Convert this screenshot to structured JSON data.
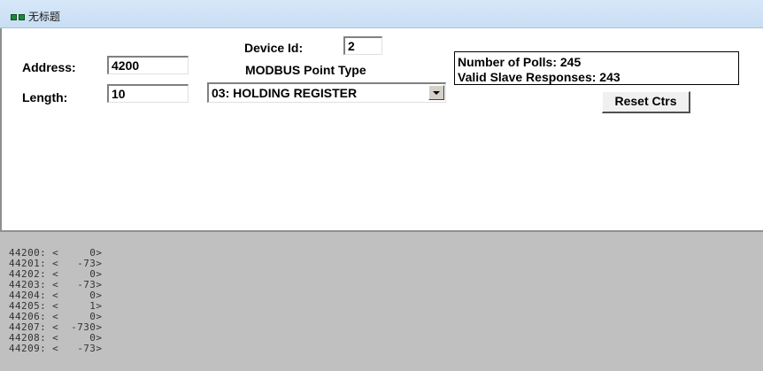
{
  "window": {
    "title": "无标题"
  },
  "form": {
    "address_label": "Address:",
    "address_value": "4200",
    "length_label": "Length:",
    "length_value": "10",
    "device_id_label": "Device Id:",
    "device_id_value": "2",
    "point_type_label": "MODBUS Point Type",
    "point_type_selected": "03: HOLDING REGISTER"
  },
  "counters": {
    "polls": "Number of Polls: 245",
    "valid_responses": "Valid Slave Responses: 243",
    "reset_label": "Reset Ctrs"
  },
  "registers": [
    {
      "address": "44200",
      "value": "0"
    },
    {
      "address": "44201",
      "value": "-73"
    },
    {
      "address": "44202",
      "value": "0"
    },
    {
      "address": "44203",
      "value": "-73"
    },
    {
      "address": "44204",
      "value": "0"
    },
    {
      "address": "44205",
      "value": "1"
    },
    {
      "address": "44206",
      "value": "0"
    },
    {
      "address": "44207",
      "value": "-730"
    },
    {
      "address": "44208",
      "value": "0"
    },
    {
      "address": "44209",
      "value": "-73"
    }
  ]
}
